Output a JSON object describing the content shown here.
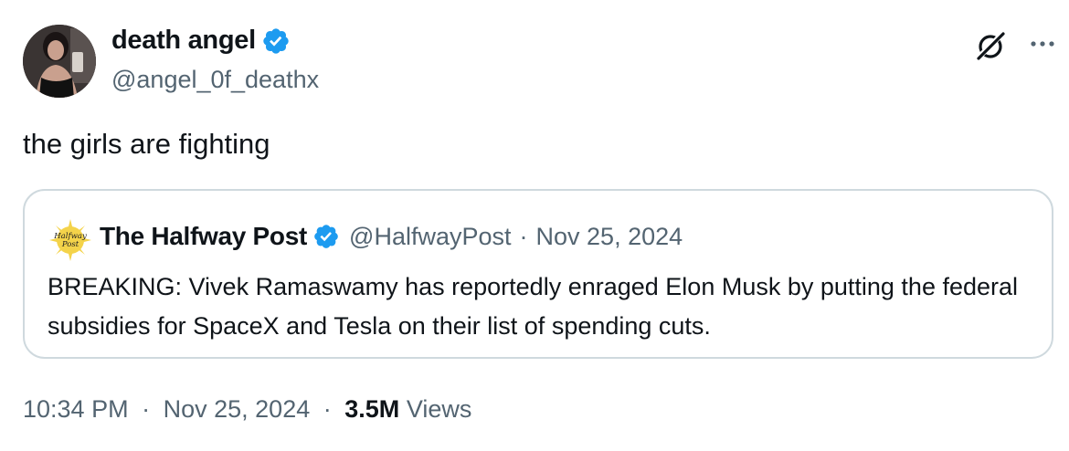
{
  "author": {
    "display_name": "death angel",
    "handle": "@angel_0f_deathx",
    "verified": true
  },
  "tweet": {
    "text": "the girls are fighting"
  },
  "quote": {
    "logo_text": "Halfway Post",
    "display_name": "The Halfway Post",
    "handle": "@HalfwayPost",
    "separator": "·",
    "date": "Nov 25, 2024",
    "verified": true,
    "text": "BREAKING: Vivek Ramaswamy has reportedly enraged Elon Musk by putting the federal subsidies for SpaceX and Tesla on their list of spending cuts."
  },
  "footer": {
    "time": "10:34 PM",
    "sep1": "·",
    "date": "Nov 25, 2024",
    "sep2": "·",
    "views_count": "3.5M",
    "views_label": "Views"
  },
  "icons": {
    "grok": "grok-icon",
    "more": "more-icon",
    "verified": "verified-badge-icon"
  },
  "colors": {
    "verified_blue": "#1d9bf0",
    "secondary_text": "#536471",
    "border": "#cfd9de",
    "logo_yellow": "#f4d34a"
  }
}
